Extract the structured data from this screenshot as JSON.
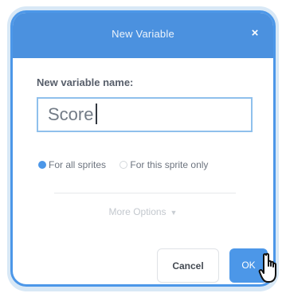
{
  "dialog": {
    "title": "New Variable",
    "close_glyph": "×",
    "name_label": "New variable name:",
    "name_value": "Score",
    "scope_options": [
      {
        "label": "For all sprites",
        "selected": true
      },
      {
        "label": "For this sprite only",
        "selected": false
      }
    ],
    "more_options_label": "More Options",
    "more_options_glyph": "▼",
    "cancel_label": "Cancel",
    "ok_label": "OK"
  },
  "colors": {
    "accent": "#4c97e8",
    "titlebar": "#4b91df",
    "frame": "#d8e8f6"
  },
  "icons": {
    "close": "close-icon",
    "more_options": "chevron-down-icon",
    "pointer": "hand-pointer-cursor-icon"
  }
}
